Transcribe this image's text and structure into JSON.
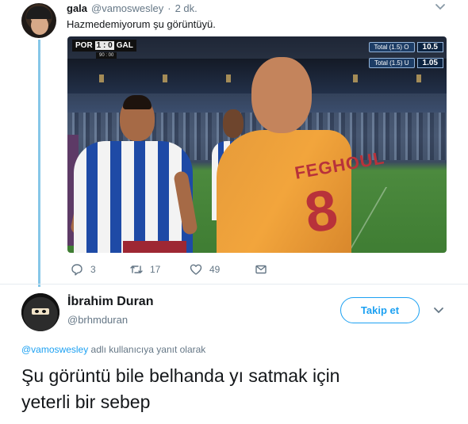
{
  "quoted_tweet": {
    "name": "gala",
    "handle": "@vamoswesley",
    "separator": "·",
    "time": "2 dk.",
    "text": "Hazmedemiyorum şu görüntüyü.",
    "media": {
      "scoreboard": {
        "home": "POR",
        "score": "1 : 0",
        "away": "GAL",
        "clock": "90 : 00"
      },
      "odds": [
        {
          "label": "Total (1.5) O",
          "value": "10.5"
        },
        {
          "label": "Total (1.5) U",
          "value": "1.05"
        }
      ],
      "jersey_name": "FEGHOUL",
      "jersey_number": "8"
    },
    "actions": {
      "replies": "3",
      "retweets": "17",
      "likes": "49"
    }
  },
  "tweet": {
    "name": "İbrahim Duran",
    "handle": "@brhmduran",
    "follow_label": "Takip et",
    "reply_to_mention": "@vamoswesley",
    "reply_to_suffix": " adlı kullanıcıya yanıt olarak",
    "text_lines": [
      "Şu görüntü bile belhanda yı satmak için",
      "yeterli bir sebep"
    ]
  },
  "colors": {
    "accent": "#1da1f2",
    "thread_line": "#86c7e8",
    "secondary_text": "#657786"
  }
}
